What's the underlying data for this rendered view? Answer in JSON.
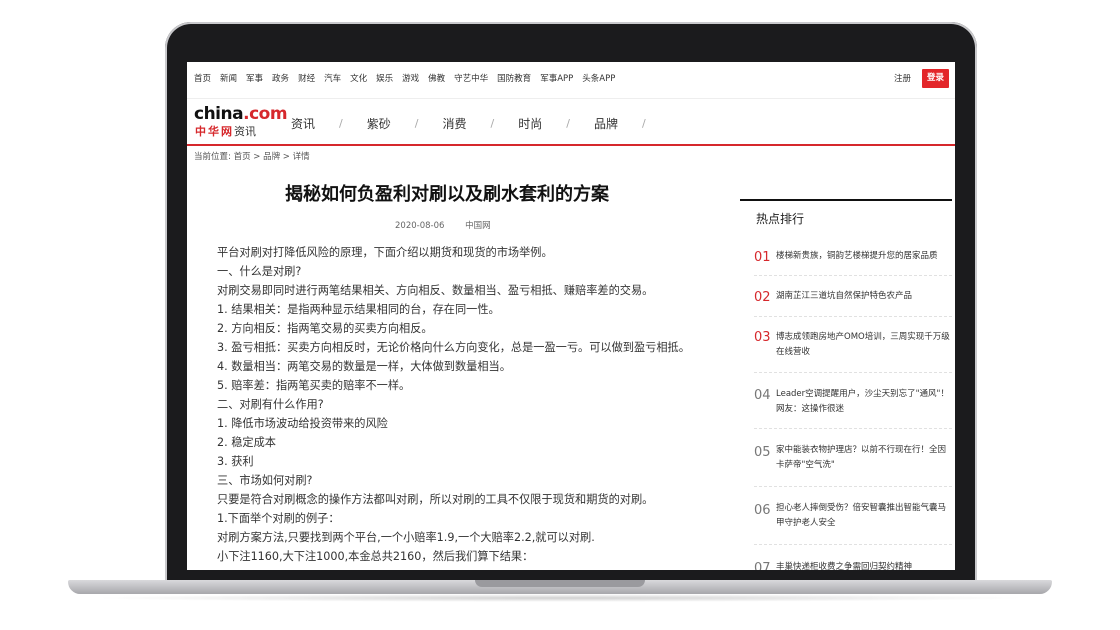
{
  "topnav": {
    "links": [
      "首页",
      "新闻",
      "军事",
      "政务",
      "财经",
      "汽车",
      "文化",
      "娱乐",
      "游戏",
      "佛教",
      "守艺中华",
      "国防教育",
      "军事APP",
      "头条APP"
    ],
    "register": "注册",
    "login": "登录"
  },
  "logo": {
    "main_prefix": "china",
    "main_dot": ".",
    "main_suffix": "com",
    "sub": "中华网",
    "sub_channel": "资讯"
  },
  "catnav": [
    "资讯",
    "紫砂",
    "消费",
    "时尚",
    "品牌"
  ],
  "catnav_sep": "/",
  "breadcrumb": "当前位置: 首页 > 品牌 > 详情",
  "article": {
    "title": "揭秘如何负盈利对刷以及刷水套利的方案",
    "date": "2020-08-06",
    "source": "中国网",
    "paragraphs": [
      "平台对刷对打降低风险的原理，下面介绍以期货和现货的市场举例。",
      "一、什么是对刷?",
      "对刷交易即同时进行两笔结果相关、方向相反、数量相当、盈亏相抵、赚赔率差的交易。",
      "1. 结果相关：是指两种显示结果相同的台，存在同一性。",
      "2. 方向相反：指两笔交易的买卖方向相反。",
      "3. 盈亏相抵：买卖方向相反时，无论价格向什么方向变化，总是一盈一亏。可以做到盈亏相抵。",
      "4. 数量相当：两笔交易的数量是一样，大体做到数量相当。",
      "5. 赔率差：指两笔买卖的赔率不一样。",
      "二、对刷有什么作用?",
      "1. 降低市场波动给投资带来的风险",
      "2. 稳定成本",
      "3. 获利",
      "三、市场如何对刷?",
      "只要是符合对刷概念的操作方法都叫对刷，所以对刷的工具不仅限于现货和期货的对刷。",
      "1.下面举个对刷的例子：",
      "对刷方案方法,只要找到两个平台,一个小赔率1.9,一个大赔率2.2,就可以对刷.",
      "小下注1160,大下注1000,本金总共2160，然后我们算下结果："
    ]
  },
  "sidebar": {
    "title": "热点排行",
    "items": [
      {
        "num": "01",
        "text": "楼梯新贵族，铜韵艺楼梯提升您的居家品质"
      },
      {
        "num": "02",
        "text": "湖南芷江三道坑自然保护特色农产品"
      },
      {
        "num": "03",
        "text": "博志成领跑房地产OMO培训，三周实现千万级在线营收"
      },
      {
        "num": "04",
        "text": "Leader空调提醒用户，沙尘天别忘了\"通风\"！网友：这操作很迷"
      },
      {
        "num": "05",
        "text": "家中能装衣物护理店？以前不行现在行！全因卡萨帝\"空气洗\""
      },
      {
        "num": "06",
        "text": "担心老人摔倒受伤？倍安智囊推出智能气囊马甲守护老人安全"
      },
      {
        "num": "07",
        "text": "丰巢快递柜收费之争需回归契约精神"
      }
    ]
  }
}
